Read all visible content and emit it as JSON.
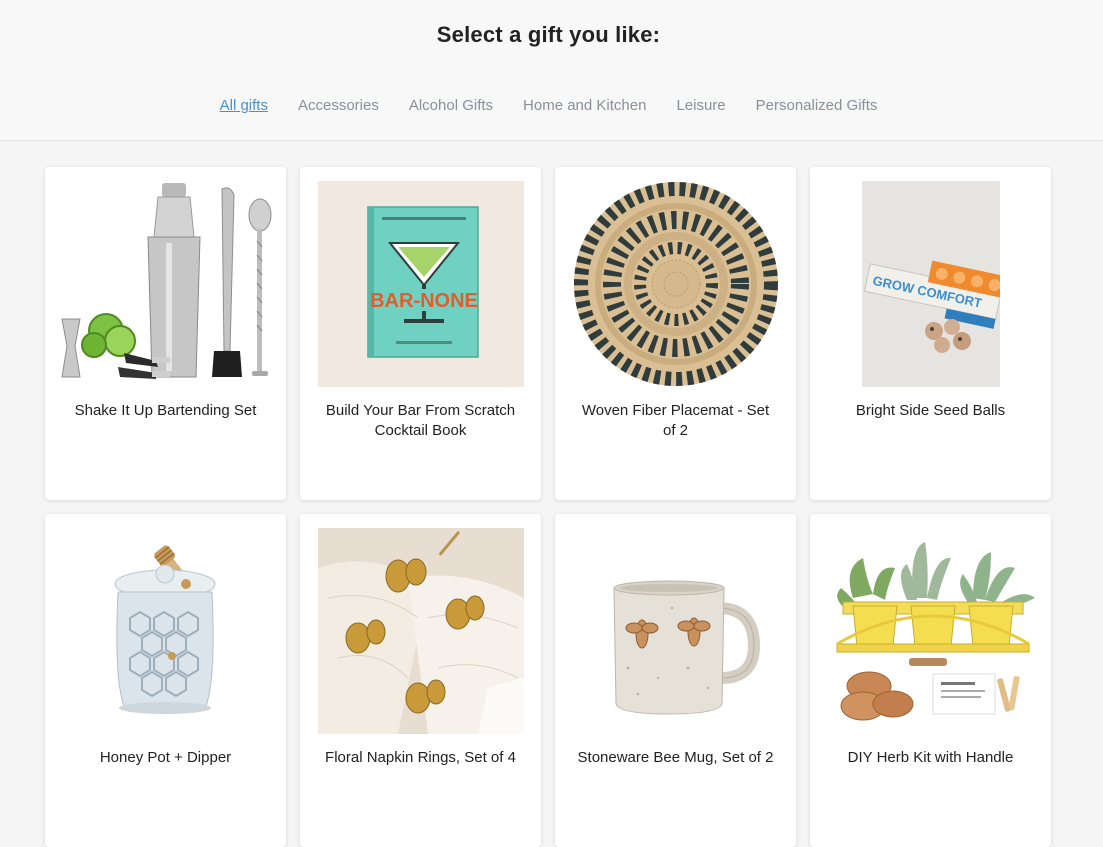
{
  "header": {
    "title": "Select a gift you like:"
  },
  "tabs": [
    {
      "label": "All gifts",
      "active": true
    },
    {
      "label": "Accessories",
      "active": false
    },
    {
      "label": "Alcohol Gifts",
      "active": false
    },
    {
      "label": "Home and Kitchen",
      "active": false
    },
    {
      "label": "Leisure",
      "active": false
    },
    {
      "label": "Personalized Gifts",
      "active": false
    }
  ],
  "products": [
    {
      "name": "Shake It Up Bartending Set",
      "image": "bartending-set-image"
    },
    {
      "name": "Build Your Bar From Scratch Cocktail Book",
      "image": "cocktail-book-image",
      "cover_text": "BAR-NONE"
    },
    {
      "name": "Woven Fiber Placemat - Set of 2",
      "image": "woven-placemat-image"
    },
    {
      "name": "Bright Side Seed Balls",
      "image": "seed-balls-image",
      "package_text": "GROW COMFORT"
    },
    {
      "name": "Honey Pot + Dipper",
      "image": "honey-pot-image"
    },
    {
      "name": "Floral Napkin Rings, Set of 4",
      "image": "napkin-rings-image"
    },
    {
      "name": "Stoneware Bee Mug, Set of 2",
      "image": "bee-mug-image"
    },
    {
      "name": "DIY Herb Kit with Handle",
      "image": "herb-kit-image"
    }
  ],
  "colors": {
    "tab_active": "#4a8fcf",
    "tab_inactive": "#8a8f99",
    "background": "#f5f5f5",
    "card": "#ffffff"
  }
}
